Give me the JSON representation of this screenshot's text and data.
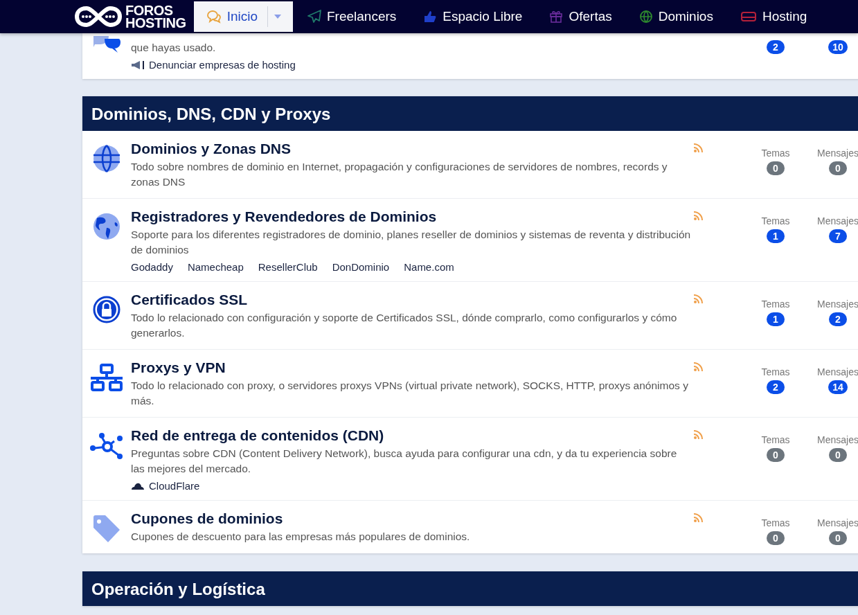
{
  "nav": {
    "logo": {
      "line1": "FOROS",
      "line2": "HOSTING"
    },
    "items": [
      {
        "label": "Inicio",
        "kind": "chat",
        "selected": true,
        "dropdown": true
      },
      {
        "label": "Freelancers",
        "kind": "plane",
        "selected": false,
        "dropdown": false
      },
      {
        "label": "Espacio Libre",
        "kind": "thumb",
        "selected": false,
        "dropdown": false
      },
      {
        "label": "Ofertas",
        "kind": "gift",
        "selected": false,
        "dropdown": false
      },
      {
        "label": "Dominios",
        "kind": "globe",
        "selected": false,
        "dropdown": false
      },
      {
        "label": "Hosting",
        "kind": "server",
        "selected": false,
        "dropdown": false
      }
    ]
  },
  "top_card": {
    "description": "que hayas usado.",
    "link": "Denunciar empresas de hosting",
    "stats": [
      {
        "value": "2",
        "color": "#0b4ee8"
      },
      {
        "value": "10",
        "color": "#0b4ee8"
      }
    ]
  },
  "sections": [
    {
      "title": "Dominios, DNS, CDN y Proxys",
      "forums": [
        {
          "kind": "globe",
          "title": "Dominios y Zonas DNS",
          "description": "Todo sobre nombres de dominio en Internet, propagación y configuraciones de servidores de nombres, records y zonas DNS",
          "stats": [
            {
              "label": "Temas",
              "value": "0",
              "color": "#6c757d"
            },
            {
              "label": "Mensajes",
              "value": "0",
              "color": "#6c757d"
            }
          ]
        },
        {
          "kind": "earth",
          "title": "Registradores y Revendedores de Dominios",
          "description": "Soporte para los diferentes registradores de dominio, planes reseller de dominios y sistemas de reventa y distribución de dominios",
          "links": [
            {
              "label": "Godaddy",
              "icon": false
            },
            {
              "label": "Namecheap",
              "icon": false
            },
            {
              "label": "ResellerClub",
              "icon": false
            },
            {
              "label": "DonDominio",
              "icon": false
            },
            {
              "label": "Name.com",
              "icon": false
            }
          ],
          "stats": [
            {
              "label": "Temas",
              "value": "1",
              "color": "#0b4ee8"
            },
            {
              "label": "Mensajes",
              "value": "7",
              "color": "#0b4ee8"
            }
          ]
        },
        {
          "kind": "lock",
          "title": "Certificados SSL",
          "description": "Todo lo relacionado con configuración y soporte de Certificados SSL, dónde comprarlo, como configurarlos y cómo generarlos.",
          "stats": [
            {
              "label": "Temas",
              "value": "1",
              "color": "#0b4ee8"
            },
            {
              "label": "Mensajes",
              "value": "2",
              "color": "#0b4ee8"
            }
          ]
        },
        {
          "kind": "network",
          "title": "Proxys y VPN",
          "description": "Todo lo relacionado con proxy, o servidores proxys VPNs (virtual private network), SOCKS, HTTP, proxys anónimos y más.",
          "stats": [
            {
              "label": "Temas",
              "value": "2",
              "color": "#0b4ee8"
            },
            {
              "label": "Mensajes",
              "value": "14",
              "color": "#0b4ee8"
            }
          ]
        },
        {
          "kind": "nodes",
          "title": "Red de entrega de contenidos (CDN)",
          "description": "Preguntas sobre CDN (Content Delivery Network), busca ayuda para configurar una cdn, y da tu experiencia sobre las mejores del mercado.",
          "links": [
            {
              "label": "CloudFlare",
              "icon": true
            }
          ],
          "stats": [
            {
              "label": "Temas",
              "value": "0",
              "color": "#6c757d"
            },
            {
              "label": "Mensajes",
              "value": "0",
              "color": "#6c757d"
            }
          ]
        },
        {
          "kind": "tag",
          "title": "Cupones de dominios",
          "description": "Cupones de descuento para las empresas más populares de dominios.",
          "stats": [
            {
              "label": "Temas",
              "value": "0",
              "color": "#6c757d"
            },
            {
              "label": "Mensajes",
              "value": "0",
              "color": "#6c757d"
            }
          ]
        }
      ]
    },
    {
      "title": "Operación y Logística"
    }
  ]
}
